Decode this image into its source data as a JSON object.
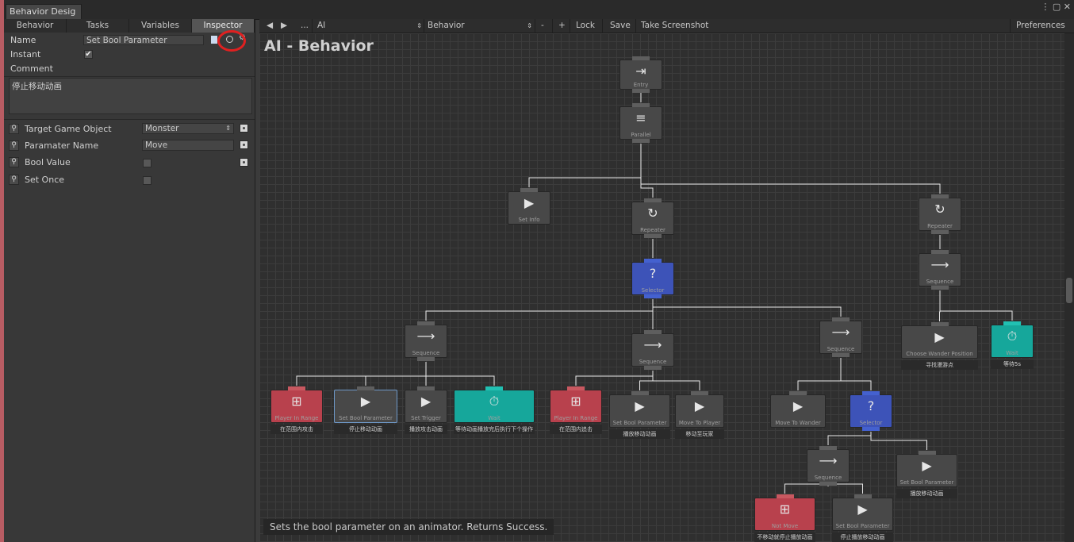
{
  "window": {
    "tab_title": "Behavior Desig",
    "controls": "⋮ ▢ ✕"
  },
  "left_panel": {
    "tabs": [
      "Behavior",
      "Tasks",
      "Variables",
      "Inspector"
    ],
    "active_tab": "Inspector",
    "name_label": "Name",
    "name_value": "Set Bool Parameter",
    "instant_label": "Instant",
    "instant_checked": "✔",
    "comment_label": "Comment",
    "comment_value": "停止移动动画",
    "fields": [
      {
        "label": "Target Game Object",
        "value": "Monster",
        "has_dropdown": true,
        "has_dot": true
      },
      {
        "label": "Paramater Name",
        "value": "Move",
        "has_dot": true
      },
      {
        "label": "Bool Value",
        "value": "",
        "checkbox": true,
        "has_dot": true
      },
      {
        "label": "Set Once",
        "value": "",
        "checkbox": true,
        "has_dot": false
      }
    ]
  },
  "toolbar": {
    "back": "◀",
    "forward": "▶",
    "more": "...",
    "object_field": "AI",
    "behavior_field": "Behavior",
    "minus": "-",
    "plus": "+",
    "lock": "Lock",
    "save": "Save",
    "screenshot": "Take Screenshot",
    "preferences": "Preferences"
  },
  "canvas": {
    "title": "AI - Behavior",
    "status": "Sets the bool parameter on an animator. Returns Success."
  },
  "nodes": [
    {
      "id": "entry",
      "title": "Entry",
      "icon": "⇥",
      "style": "gray"
    },
    {
      "id": "parallel",
      "title": "Parallel",
      "icon": "≡",
      "style": "gray"
    },
    {
      "id": "setinfo",
      "title": "Set Info",
      "icon": "▶",
      "style": "gray"
    },
    {
      "id": "repeater1",
      "title": "Repeater",
      "icon": "↻",
      "style": "gray"
    },
    {
      "id": "repeater2",
      "title": "Repeater",
      "icon": "↻",
      "style": "gray"
    },
    {
      "id": "selector1",
      "title": "Selector",
      "icon": "?",
      "style": "blue"
    },
    {
      "id": "seq_r",
      "title": "Sequence",
      "icon": "⟶",
      "style": "gray"
    },
    {
      "id": "seq1",
      "title": "Sequence",
      "icon": "⟶",
      "style": "gray"
    },
    {
      "id": "seq2",
      "title": "Sequence",
      "icon": "⟶",
      "style": "gray"
    },
    {
      "id": "seq3",
      "title": "Sequence",
      "icon": "⟶",
      "style": "gray"
    },
    {
      "id": "cwp",
      "title": "Choose Wander Position",
      "icon": "▶",
      "style": "gray",
      "comment": "寻找漫游点"
    },
    {
      "id": "wait_r",
      "title": "Wait",
      "icon": "⏱",
      "style": "teal",
      "comment": "等待5s"
    },
    {
      "id": "pir1",
      "title": "Player In Range",
      "icon": "⊞",
      "style": "red",
      "comment": "在范围内攻击"
    },
    {
      "id": "sbp_sel",
      "title": "Set Bool Parameter",
      "icon": "▶",
      "style": "gray",
      "selected": true,
      "comment": "停止移动动画"
    },
    {
      "id": "settrig",
      "title": "Set Trigger",
      "icon": "▶",
      "style": "gray",
      "comment": "播放攻击动画"
    },
    {
      "id": "wait1",
      "title": "Wait",
      "icon": "⏱",
      "style": "teal",
      "comment": "等待动画播放完后执行下个操作"
    },
    {
      "id": "pir2",
      "title": "Player In Range",
      "icon": "⊞",
      "style": "red",
      "comment": "在范围内追击"
    },
    {
      "id": "sbp2",
      "title": "Set Bool Parameter",
      "icon": "▶",
      "style": "gray",
      "comment": "播放移动动画"
    },
    {
      "id": "mtp",
      "title": "Move To Player",
      "icon": "▶",
      "style": "gray",
      "comment": "移动至玩家"
    },
    {
      "id": "mtw",
      "title": "Move To Wander",
      "icon": "▶",
      "style": "gray"
    },
    {
      "id": "selector2",
      "title": "Selector",
      "icon": "?",
      "style": "blue"
    },
    {
      "id": "seq4",
      "title": "Sequence",
      "icon": "⟶",
      "style": "gray"
    },
    {
      "id": "sbp3",
      "title": "Set Bool Parameter",
      "icon": "▶",
      "style": "gray",
      "comment": "播放移动动画"
    },
    {
      "id": "notmove",
      "title": "Not Move",
      "icon": "⊞",
      "style": "red",
      "comment": "不移动就停止播放动画"
    },
    {
      "id": "sbp4",
      "title": "Set Bool Parameter",
      "icon": "▶",
      "style": "gray",
      "comment": "停止播放移动动画"
    }
  ],
  "colors": {
    "accent_red": "#e02020",
    "selector_blue": "#3d53b8",
    "wait_teal": "#16a79b",
    "condition_red": "#b8414d"
  }
}
